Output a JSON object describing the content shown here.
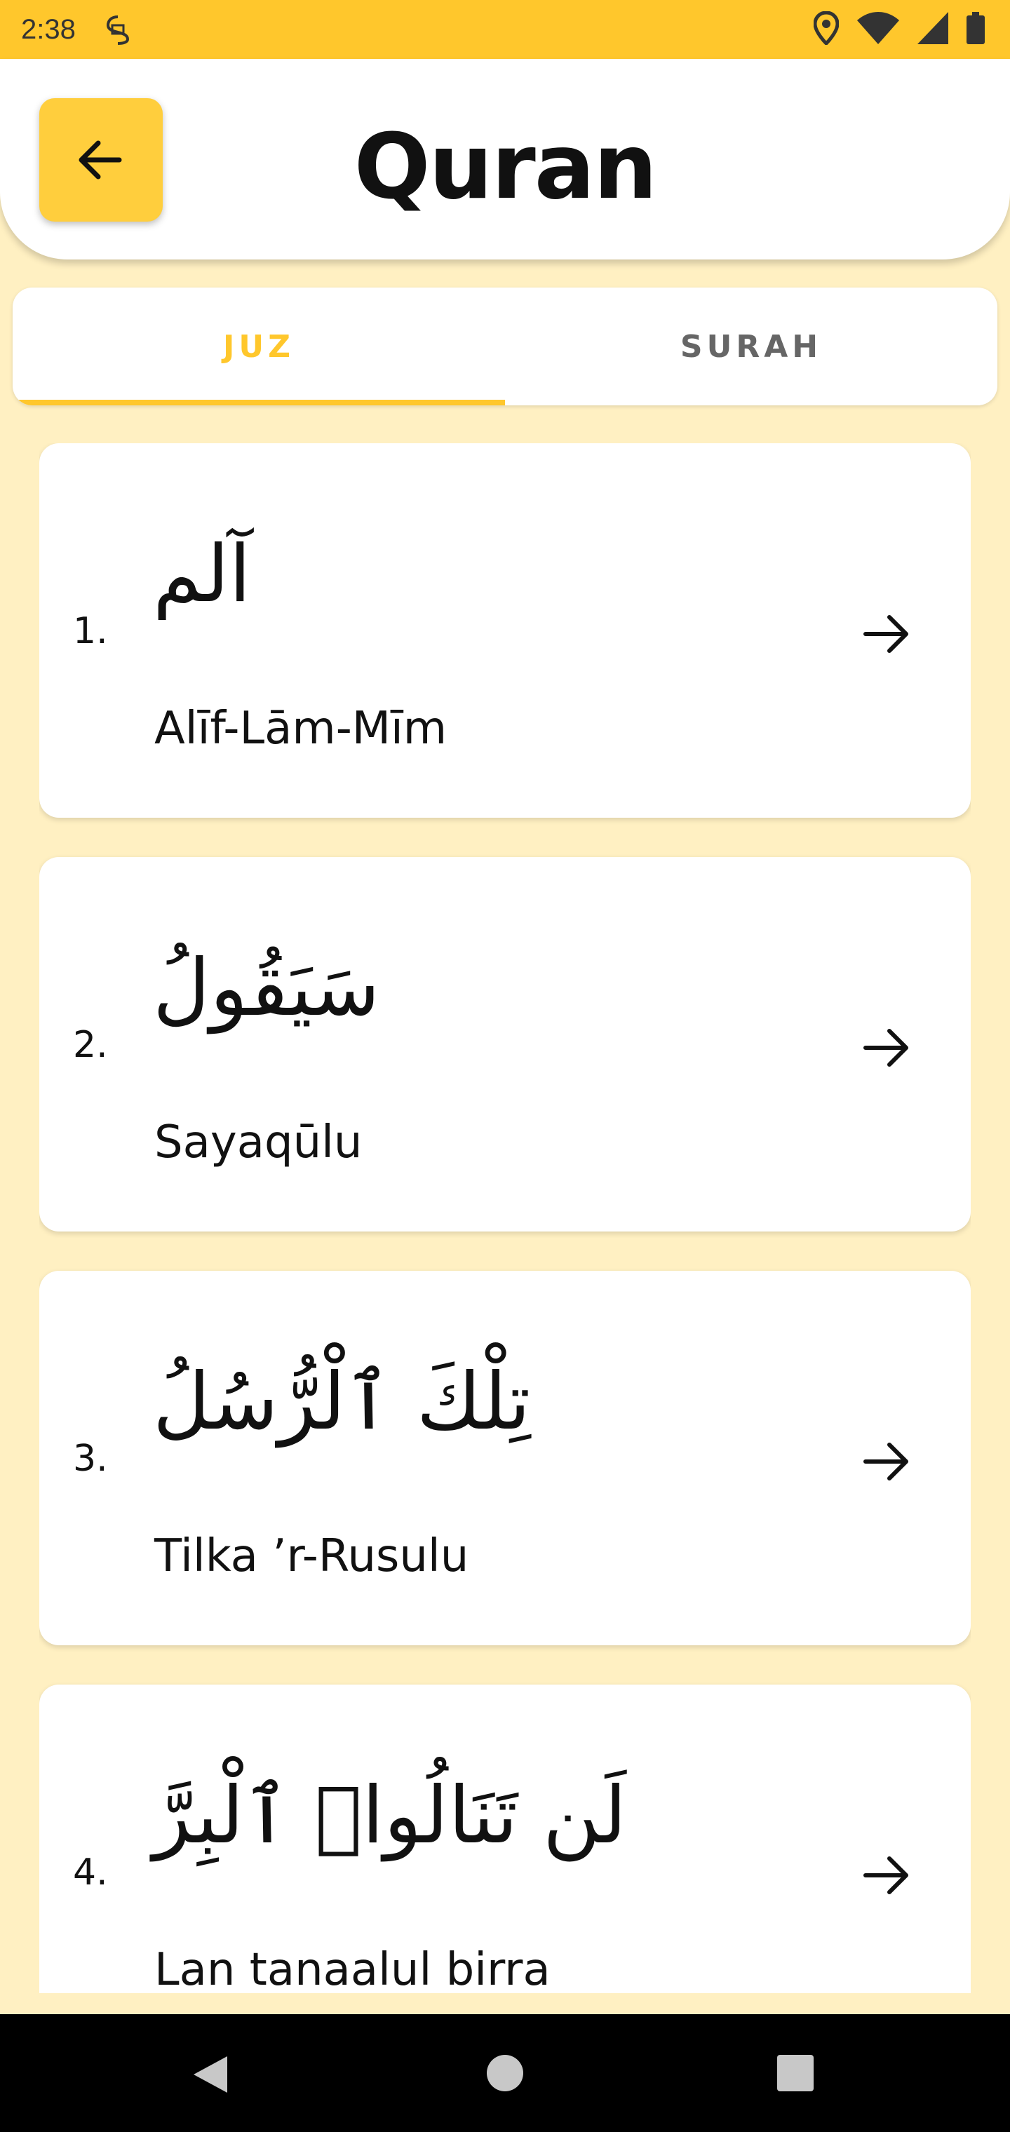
{
  "status_bar": {
    "time": "2:38",
    "left_icon": "sim-icon",
    "right_icons": [
      "location-icon",
      "wifi-icon",
      "signal-icon",
      "battery-icon"
    ]
  },
  "header": {
    "title": "Quran",
    "back_icon": "arrow-left-icon"
  },
  "tabs": [
    {
      "label": "JUZ",
      "active": true
    },
    {
      "label": "SURAH",
      "active": false
    }
  ],
  "juz_list": [
    {
      "number": "1.",
      "arabic": "آلم",
      "latin": "Alīf-Lām-Mīm"
    },
    {
      "number": "2.",
      "arabic": "سَيَقُولُ",
      "latin": "Sayaqūlu"
    },
    {
      "number": "3.",
      "arabic": "تِلْكَ ٱلْرُّسُلُ",
      "latin": "Tilka ’r-Rusulu"
    },
    {
      "number": "4.",
      "arabic": "لَن تَنَالُوا۟ ٱلْبِرَّ",
      "latin": "Lan tanaalul birra"
    }
  ],
  "colors": {
    "accent": "#FFC72C",
    "background": "#FFF0C2",
    "card": "#FFFFFF"
  },
  "nav": [
    "back-nav-icon",
    "home-nav-icon",
    "recents-nav-icon"
  ]
}
